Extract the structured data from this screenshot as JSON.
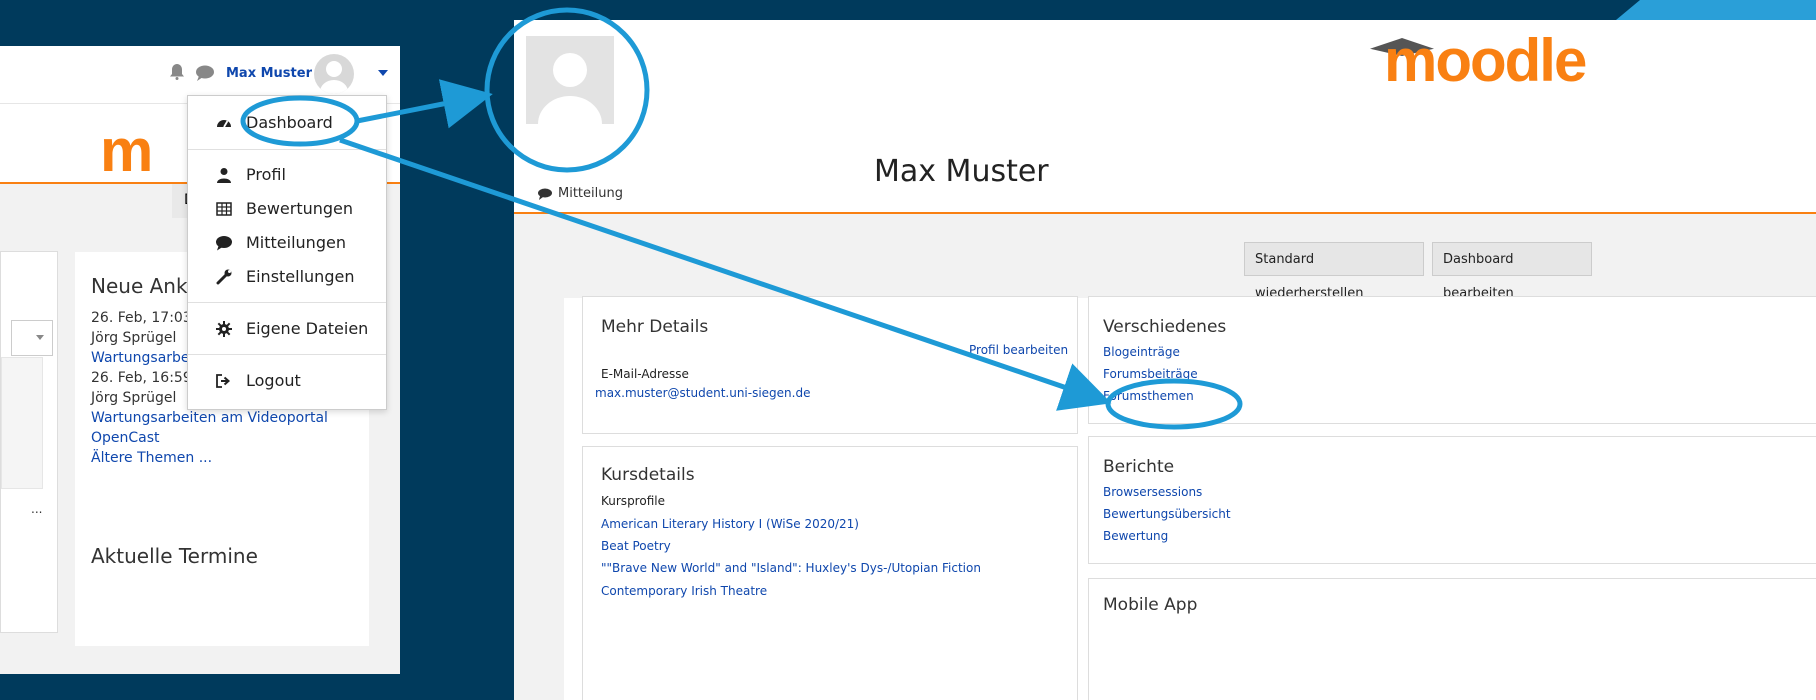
{
  "left_panel": {
    "username": "Max Muster",
    "logo_text": "m",
    "tab_label": "D",
    "news": {
      "title": "Neue Ankü",
      "lines": [
        "26. Feb, 17:03",
        "Jörg Sprügel",
        "Wartungsarbei",
        "26. Feb, 16:59",
        "Jörg Sprügel",
        "Wartungsarbeiten am Videoportal",
        "OpenCast",
        "Ältere Themen ..."
      ]
    },
    "termine_title": "Aktuelle Termine",
    "dots": "..."
  },
  "menu": {
    "items": [
      {
        "label": "Dashboard",
        "icon": "dashboard-icon"
      },
      {
        "label": "Profil",
        "icon": "user-icon"
      },
      {
        "label": "Bewertungen",
        "icon": "table-icon"
      },
      {
        "label": "Mitteilungen",
        "icon": "chat-icon"
      },
      {
        "label": "Einstellungen",
        "icon": "wrench-icon"
      },
      {
        "label": "Eigene Dateien",
        "icon": "gear-icon"
      },
      {
        "label": "Logout",
        "icon": "logout-icon"
      }
    ]
  },
  "right_panel": {
    "logo_text": "moodle",
    "name": "Max Muster",
    "message_label": "Mitteilung",
    "buttons": {
      "reset": "Standard wiederherstellen",
      "edit": "Dashboard bearbeiten"
    },
    "mehr_details": {
      "title": "Mehr Details",
      "edit_link": "Profil bearbeiten",
      "email_label": "E-Mail-Adresse",
      "email": "max.muster@student.uni-siegen.de"
    },
    "verschiedenes": {
      "title": "Verschiedenes",
      "links": [
        "Blogeinträge",
        "Forumsbeiträge",
        "Forumsthemen"
      ]
    },
    "kursdetails": {
      "title": "Kursdetails",
      "subtitle": "Kursprofile",
      "courses": [
        "American Literary History I (WiSe 2020/21)",
        "Beat Poetry",
        "\"\"Brave New World\" and \"Island\": Huxley's Dys-/Utopian Fiction",
        "Contemporary Irish Theatre"
      ]
    },
    "berichte": {
      "title": "Berichte",
      "links": [
        "Browsersessions",
        "Bewertungsübersicht",
        "Bewertung"
      ]
    },
    "mobile_title": "Mobile App"
  },
  "colors": {
    "background": "#003a5c",
    "accent": "#2a9fd8",
    "brand": "#f98012",
    "link": "#0f47ad"
  }
}
